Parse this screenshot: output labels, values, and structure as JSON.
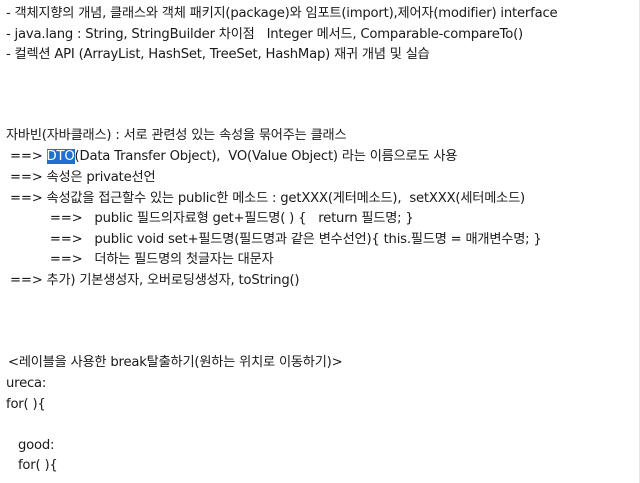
{
  "notes": {
    "bullets": [
      "- 객체지향의 개념, 클래스와 객체 패키지(package)와 임포트(import),제어자(modifier) interface",
      "- java.lang : String, StringBuilder 차이점   Integer 메서드, Comparable-compareTo()",
      "- 컬렉션 API (ArrayList, HashSet, TreeSet, HashMap) 재귀 개념 및 실습"
    ],
    "javabean_title": "자바빈(자바클래스) : 서로 관련성 있는 속성을 묶어주는 클래스",
    "dto_prefix": " ==> ",
    "dto_selected": "DTO",
    "dto_rest": "(Data Transfer Object),  VO(Value Object) 라는 이름으로도 사용",
    "private_line": " ==> 속성은 private선언",
    "method_line": " ==> 속성값을 접근할수 있는 public한 메소드 : getXXX(게터메소드),  setXXX(세터메소드)",
    "getter_line": "           ==>   public 필드의자료형 get+필드명( ) {   return 필드명; }",
    "setter_line": "           ==>   public void set+필드명(필드명과 같은 변수선언){ this.필드명 = 매개변수명; }",
    "capital_line": "           ==>   더하는 필드명의 첫글자는 대문자",
    "extra_line": " ==> 추가) 기본생성자, 오버로딩생성자, toString()",
    "label_title": " <레이블을 사용한 break탈출하기(원하는 위치로 이동하기)>",
    "code_lines": [
      "ureca:",
      "for( ){",
      "",
      "   good:",
      "   for( ){"
    ]
  }
}
